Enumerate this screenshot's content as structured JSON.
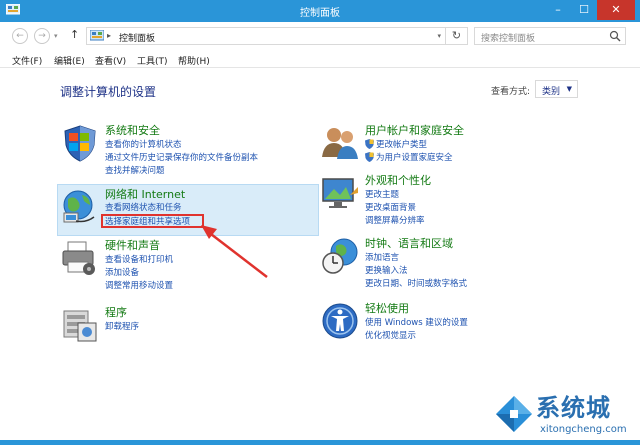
{
  "window": {
    "title": "控制面板",
    "min": "–",
    "max": "☐",
    "close": "✕"
  },
  "address": {
    "crumb_sep": "▸",
    "crumb": "控制面板",
    "search_placeholder": "搜索控制面板",
    "back": "←",
    "forward": "→",
    "up": "↑",
    "refresh": "↻",
    "dropdown": "▾"
  },
  "menu": [
    "文件(F)",
    "编辑(E)",
    "查看(V)",
    "工具(T)",
    "帮助(H)"
  ],
  "page": {
    "title": "调整计算机的设置",
    "view_by_label": "查看方式:",
    "view_by_value": "类别",
    "view_by_caret": "▼"
  },
  "categories": {
    "system": {
      "heading": "系统和安全",
      "links": [
        "查看你的计算机状态",
        "通过文件历史记录保存你的文件备份副本",
        "查找并解决问题"
      ],
      "icon": "shield-flag-icon"
    },
    "network": {
      "heading": "网络和 Internet",
      "links": [
        "查看网络状态和任务",
        "选择家庭组和共享选项"
      ],
      "icon": "network-globe-icon"
    },
    "hardware": {
      "heading": "硬件和声音",
      "links": [
        "查看设备和打印机",
        "添加设备",
        "调整常用移动设置"
      ],
      "icon": "printer-icon"
    },
    "programs": {
      "heading": "程序",
      "links": [
        "卸载程序"
      ],
      "icon": "programs-icon"
    },
    "user": {
      "heading": "用户帐户和家庭安全",
      "links": [
        "更改帐户类型",
        "为用户设置家庭安全"
      ],
      "icon": "users-icon"
    },
    "appearance": {
      "heading": "外观和个性化",
      "links": [
        "更改主题",
        "更改桌面背景",
        "调整屏幕分辨率"
      ],
      "icon": "appearance-icon"
    },
    "clock": {
      "heading": "时钟、语言和区域",
      "links": [
        "添加语言",
        "更换输入法",
        "更改日期、时间或数字格式"
      ],
      "icon": "clock-globe-icon"
    },
    "ease": {
      "heading": "轻松使用",
      "links": [
        "使用 Windows 建议的设置",
        "优化视觉显示"
      ],
      "icon": "ease-of-access-icon"
    }
  },
  "watermark": {
    "text": "系统城",
    "url": "xitongcheng.com"
  },
  "colors": {
    "titlebar": "#2a95d8",
    "heading_green": "#137a13",
    "link_blue": "#1f53b0",
    "highlight": "#d9ecf9",
    "red": "#e0332e"
  }
}
